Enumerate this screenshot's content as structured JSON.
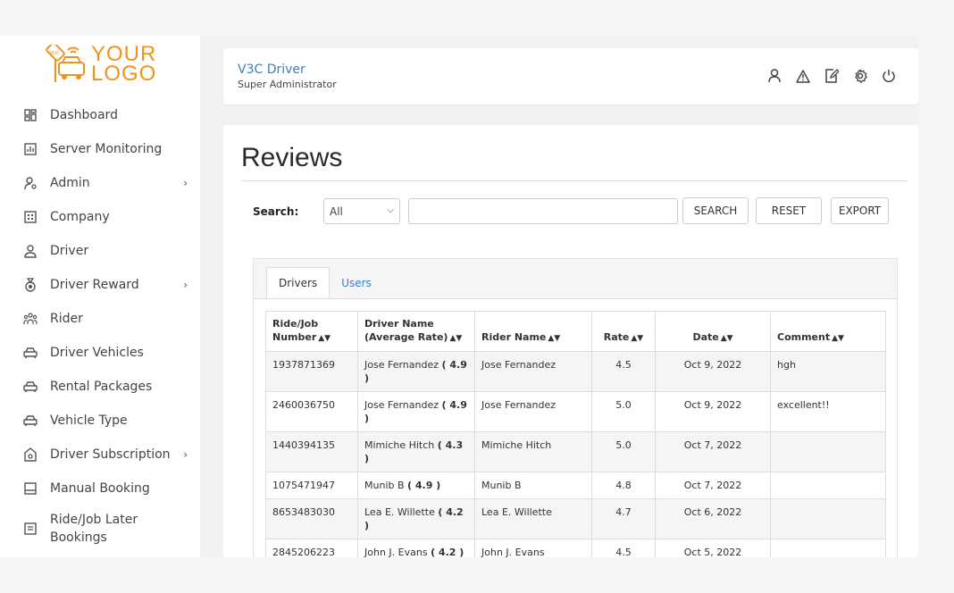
{
  "logo": {
    "line1": "YOUR",
    "line2": "LOGO",
    "badge": "TAXI"
  },
  "sidebar": {
    "items": [
      {
        "label": "Dashboard",
        "icon": "dashboard-icon"
      },
      {
        "label": "Server Monitoring",
        "icon": "chart-icon"
      },
      {
        "label": "Admin",
        "icon": "admin-user-icon",
        "has_chevron": true
      },
      {
        "label": "Company",
        "icon": "building-icon"
      },
      {
        "label": "Driver",
        "icon": "driver-icon"
      },
      {
        "label": "Driver Reward",
        "icon": "medal-icon",
        "has_chevron": true
      },
      {
        "label": "Rider",
        "icon": "rider-group-icon"
      },
      {
        "label": "Driver Vehicles",
        "icon": "car-icon"
      },
      {
        "label": "Rental Packages",
        "icon": "car-icon"
      },
      {
        "label": "Vehicle Type",
        "icon": "car-icon"
      },
      {
        "label": "Driver Subscription",
        "icon": "subscription-icon",
        "has_chevron": true
      },
      {
        "label": "Manual Booking",
        "icon": "booking-icon"
      },
      {
        "label": "Ride/Job Later Bookings",
        "icon": "list-icon"
      }
    ],
    "chevron": "›"
  },
  "header": {
    "title": "V3C Driver",
    "subtitle": "Super Administrator",
    "icons": [
      "user-icon",
      "warning-icon",
      "edit-icon",
      "settings-icon",
      "power-icon"
    ]
  },
  "page": {
    "title": "Reviews"
  },
  "search": {
    "label": "Search:",
    "select_value": "All",
    "input_value": "",
    "search_button": "SEARCH",
    "reset_button": "RESET",
    "export_button": "EXPORT"
  },
  "tabs": [
    {
      "label": "Drivers",
      "active": true
    },
    {
      "label": "Users",
      "active": false
    }
  ],
  "table": {
    "headers": {
      "ride": "Ride/Job Number",
      "driver": "Driver Name (Average Rate)",
      "rider": "Rider Name",
      "rate": "Rate",
      "date": "Date",
      "comment": "Comment"
    },
    "rows": [
      {
        "ride": "1937871369",
        "driver": "Jose Fernandez",
        "avg": "( 4.9 )",
        "rider": "Jose Fernandez",
        "rate": "4.5",
        "date": "Oct 9, 2022",
        "comment": "hgh"
      },
      {
        "ride": "2460036750",
        "driver": "Jose Fernandez",
        "avg": "( 4.9 )",
        "rider": "Jose Fernandez",
        "rate": "5.0",
        "date": "Oct 9, 2022",
        "comment": "excellent!!"
      },
      {
        "ride": "1440394135",
        "driver": "Mimiche Hitch",
        "avg": "( 4.3 )",
        "rider": "Mimiche Hitch",
        "rate": "5.0",
        "date": "Oct 7, 2022",
        "comment": ""
      },
      {
        "ride": "1075471947",
        "driver": "Munib B",
        "avg": "( 4.9 )",
        "rider": "Munib B",
        "rate": "4.8",
        "date": "Oct 7, 2022",
        "comment": ""
      },
      {
        "ride": "8653483030",
        "driver": "Lea E. Willette",
        "avg": "( 4.2 )",
        "rider": "Lea E. Willette",
        "rate": "4.7",
        "date": "Oct 6, 2022",
        "comment": ""
      },
      {
        "ride": "2845206223",
        "driver": "John J. Evans",
        "avg": "( 4.2 )",
        "rider": "John J. Evans",
        "rate": "4.5",
        "date": "Oct 5, 2022",
        "comment": ""
      }
    ]
  }
}
